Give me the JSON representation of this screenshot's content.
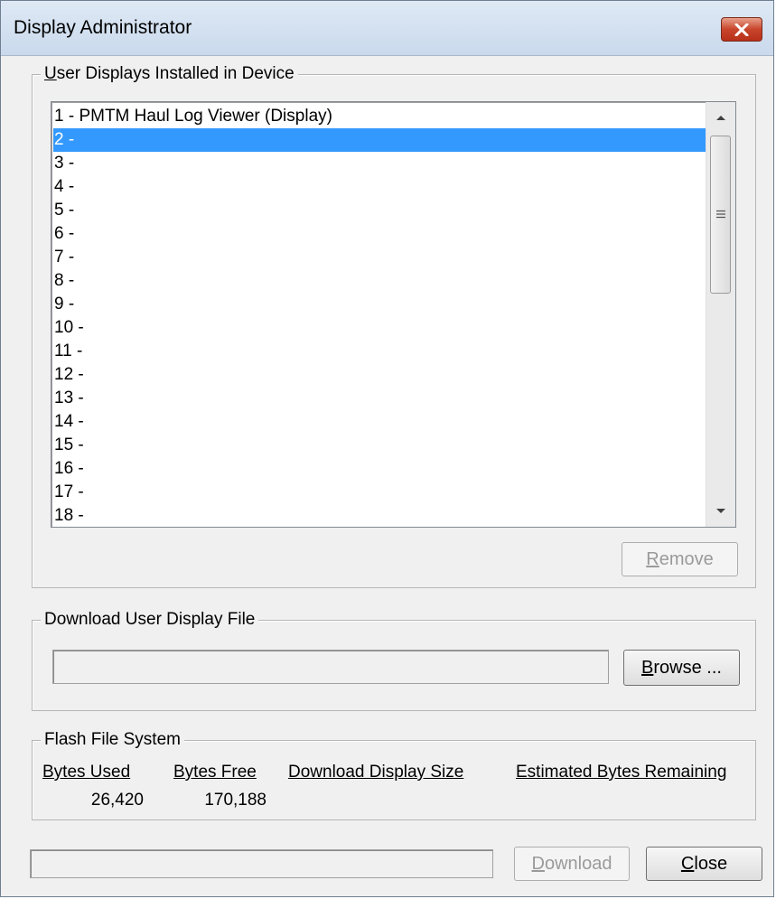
{
  "window": {
    "title": "Display Administrator",
    "close_icon": "close-x-icon"
  },
  "user_displays": {
    "group_label_accel": "U",
    "group_label_rest": "ser Displays Installed in Device",
    "items": [
      "1 - PMTM Haul Log Viewer  (Display)",
      "2 -",
      "3 -",
      "4 -",
      "5 -",
      "6 -",
      "7 -",
      "8 -",
      "9 -",
      "10 -",
      "11 -",
      "12 -",
      "13 -",
      "14 -",
      "15 -",
      "16 -",
      "17 -",
      "18 -"
    ],
    "selected_index": 1,
    "remove_accel": "R",
    "remove_rest": "emove"
  },
  "download_file": {
    "group_label": "Download User Display File",
    "path_value": "",
    "browse_accel": "B",
    "browse_rest": "rowse ..."
  },
  "flash": {
    "group_label": "Flash File System",
    "headers": {
      "bytes_used": "Bytes Used",
      "bytes_free": "Bytes Free",
      "download_display_size": "Download Display Size",
      "estimated_bytes_remaining": "Estimated Bytes Remaining"
    },
    "values": {
      "bytes_used": "26,420",
      "bytes_free": "170,188",
      "download_display_size": "",
      "estimated_bytes_remaining": ""
    }
  },
  "footer": {
    "progress_value": "",
    "download_accel": "D",
    "download_rest": "ownload",
    "close_accel": "C",
    "close_rest": "lose"
  },
  "colors": {
    "selection": "#3399ff",
    "dialog_bg": "#f0f0f0",
    "close_button": "#c8452b"
  }
}
